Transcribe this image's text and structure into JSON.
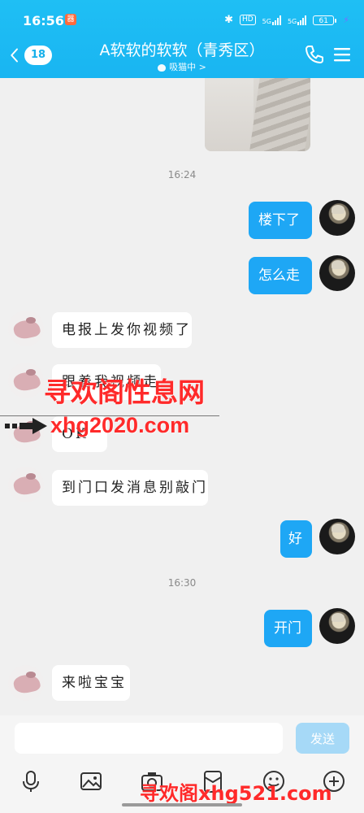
{
  "status_bar": {
    "time": "16:56",
    "app_badge": "器",
    "hd_label": "HD",
    "signal_1_label": "5G",
    "signal_2_label": "5G",
    "battery": "61"
  },
  "header": {
    "unread_count": "18",
    "contact_name": "A软软的软软（青秀区）",
    "contact_status": "吸猫中 >"
  },
  "colors": {
    "header_bg": "#1fbff4",
    "outgoing_bubble": "#1ea7f5",
    "incoming_bubble": "#ffffff",
    "chat_bg": "#f0f0f0",
    "send_button": "#a6d9f7",
    "watermark": "#ff2a2a"
  },
  "chat": {
    "timestamps": [
      "16:24",
      "16:30"
    ],
    "messages": [
      {
        "from": "me",
        "text": "楼下了"
      },
      {
        "from": "me",
        "text": "怎么走"
      },
      {
        "from": "other",
        "text": "电报上发你视频了"
      },
      {
        "from": "other",
        "text": "跟着我视频走"
      },
      {
        "from": "other",
        "text": "OK"
      },
      {
        "from": "other",
        "text": "到门口发消息别敲门"
      },
      {
        "from": "me",
        "text": "好"
      },
      {
        "from": "me",
        "text": "开门"
      },
      {
        "from": "other",
        "text": "来啦宝宝"
      }
    ]
  },
  "watermarks": {
    "top_line1": "寻欢阁性息网",
    "top_line2": "xhg2020.com",
    "bottom": "寻欢阁xhg521.com"
  },
  "input": {
    "value": "",
    "send_label": "发送"
  },
  "toolbar": {
    "icons": [
      "microphone-icon",
      "image-icon",
      "camera-icon",
      "red-packet-icon",
      "emoji-icon",
      "plus-icon"
    ]
  }
}
